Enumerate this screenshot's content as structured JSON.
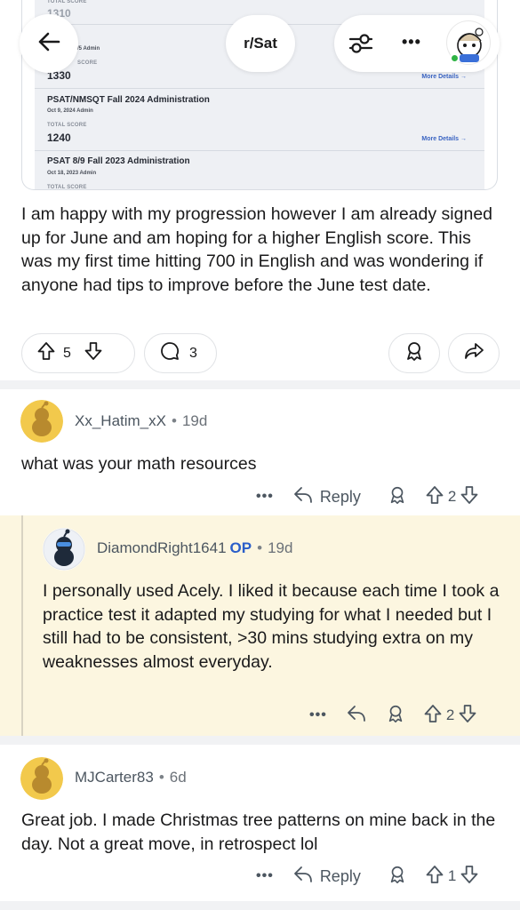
{
  "header": {
    "subreddit": "r/Sat",
    "more_label": "•••"
  },
  "score_report": {
    "top_score_partial": "1310",
    "partial_admin": "/5 Admin",
    "total_score_label": "TOTAL SCORE",
    "partial_score_label": "SCORE",
    "more_details": "More Details →",
    "rows": [
      {
        "score": "1330"
      },
      {
        "name": "PSAT/NMSQT Fall 2024 Administration",
        "date": "Oct 9, 2024 Admin",
        "score": "1240"
      },
      {
        "name": "PSAT 8/9 Fall 2023 Administration",
        "date": "Oct 18, 2023 Admin"
      }
    ]
  },
  "post": {
    "body": "I am happy with my progression however I am already signed up for June and am hoping for a higher English score. This was my first time hitting 700 in English and was wondering if anyone had tips to improve before the June test date.",
    "upvotes": "5",
    "comments": "3"
  },
  "comments": [
    {
      "username": "Xx_Hatim_xX",
      "age": "19d",
      "body": "what was your math resources",
      "reply_label": "Reply",
      "score": "2",
      "ellipsis": "•••"
    },
    {
      "username": "DiamondRight1641",
      "op_badge": "OP",
      "age": "19d",
      "body": "I personally used Acely.  I liked it because each time I took a practice test it adapted my studying for what I needed but I still had to be consistent, >30 mins studying extra on my weaknesses almost everyday.",
      "score": "2",
      "ellipsis": "•••"
    },
    {
      "username": "MJCarter83",
      "age": "6d",
      "body": "Great job. I made Christmas tree patterns on mine back in the day. Not a great move, in retrospect lol",
      "reply_label": "Reply",
      "score": "1",
      "ellipsis": "•••"
    }
  ],
  "separator": "•",
  "colors": {
    "link_blue": "#2a5ec9",
    "reply_highlight": "#fcf6e0",
    "online": "#2fb344",
    "snoo_yellow": "#f2c94c"
  }
}
